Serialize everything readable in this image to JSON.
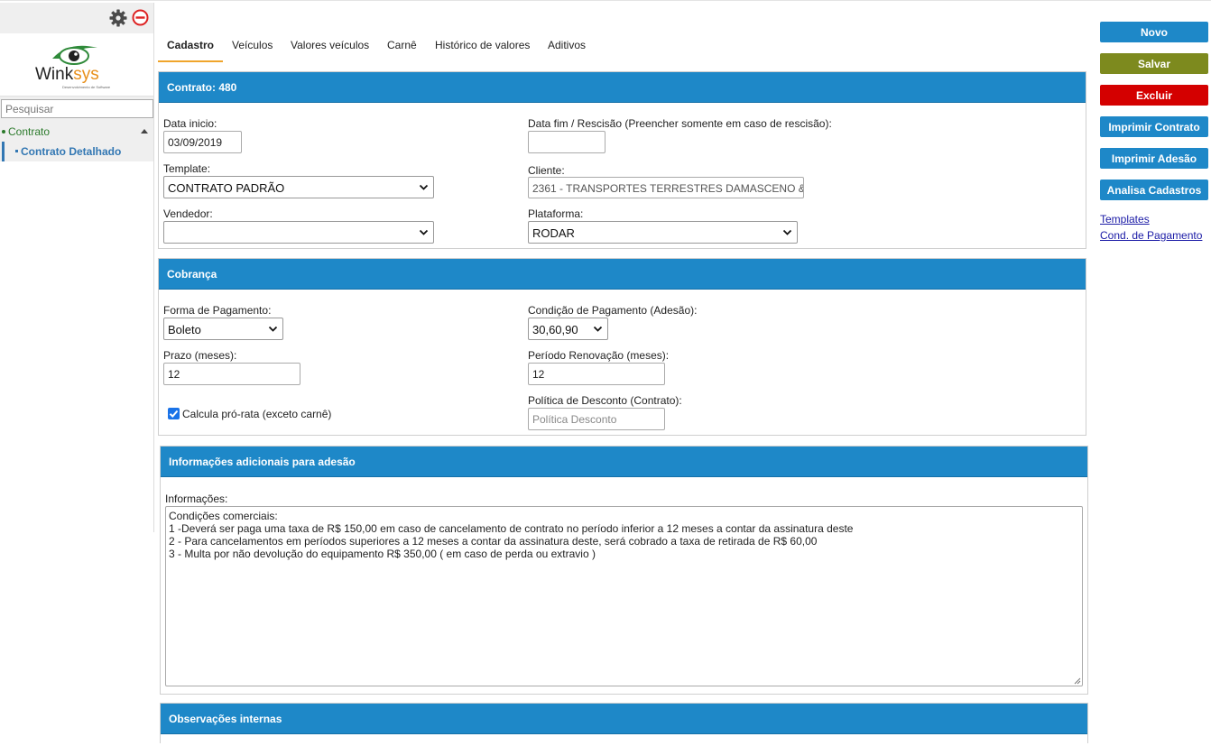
{
  "sidebar": {
    "logo_text": "Winksys",
    "logo_tagline": "Desenvolvimento de Software",
    "search_placeholder": "Pesquisar",
    "tree_root": "Contrato",
    "tree_child": "Contrato Detalhado",
    "icons": [
      "gear-icon",
      "minus-circle-icon"
    ]
  },
  "tabs": [
    "Cadastro",
    "Veículos",
    "Valores veículos",
    "Carnê",
    "Histórico de valores",
    "Aditivos"
  ],
  "contrato": {
    "header": "Contrato: 480",
    "data_inicio_label": "Data inicio:",
    "data_inicio_value": "03/09/2019",
    "data_fim_label": "Data fim / Rescisão (Preencher somente em caso de rescisão):",
    "data_fim_value": "",
    "template_label": "Template:",
    "template_value": "CONTRATO PADRÃO",
    "cliente_label": "Cliente:",
    "cliente_value": "2361 - TRANSPORTES TERRESTRES DAMASCENO &",
    "vendedor_label": "Vendedor:",
    "vendedor_value": "",
    "plataforma_label": "Plataforma:",
    "plataforma_value": "RODAR"
  },
  "cobranca": {
    "header": "Cobrança",
    "forma_label": "Forma de Pagamento:",
    "forma_value": "Boleto",
    "condicao_label": "Condição de Pagamento (Adesão):",
    "condicao_value": "30,60,90",
    "prazo_label": "Prazo (meses):",
    "prazo_value": "12",
    "periodo_label": "Período Renovação (meses):",
    "periodo_value": "12",
    "prorata_label": "Calcula pró-rata (exceto carnê)",
    "prorata_checked": true,
    "politica_label": "Política de Desconto (Contrato):",
    "politica_placeholder": "Política Desconto"
  },
  "adesao": {
    "header": "Informações adicionais para adesão",
    "info_label": "Informações:",
    "info_lines": [
      "Condições comerciais:",
      "1 -Deverá ser paga uma taxa de R$ 150,00 em caso de cancelamento de contrato no período inferior a 12 meses a contar da assinatura deste",
      "2 - Para cancelamentos em períodos superiores a 12 meses a contar da assinatura deste, será cobrado a taxa de retirada de R$ 60,00",
      "3 - Multa por não devolução do equipamento R$ 350,00 ( em caso de perda ou extravio )"
    ]
  },
  "observacoes": {
    "header": "Observações internas"
  },
  "actions": {
    "novo": "Novo",
    "salvar": "Salvar",
    "excluir": "Excluir",
    "imprimir_contrato": "Imprimir Contrato",
    "imprimir_adesao": "Imprimir Adesão",
    "analisa_cadastros": "Analisa Cadastros",
    "link_templates": "Templates",
    "link_cond_pagamento": "Cond. de Pagamento"
  },
  "colors": {
    "header_blue": "#1e88c8",
    "olive": "#7d8a1e",
    "red": "#d40000",
    "tab_accent": "#f0a52c"
  }
}
